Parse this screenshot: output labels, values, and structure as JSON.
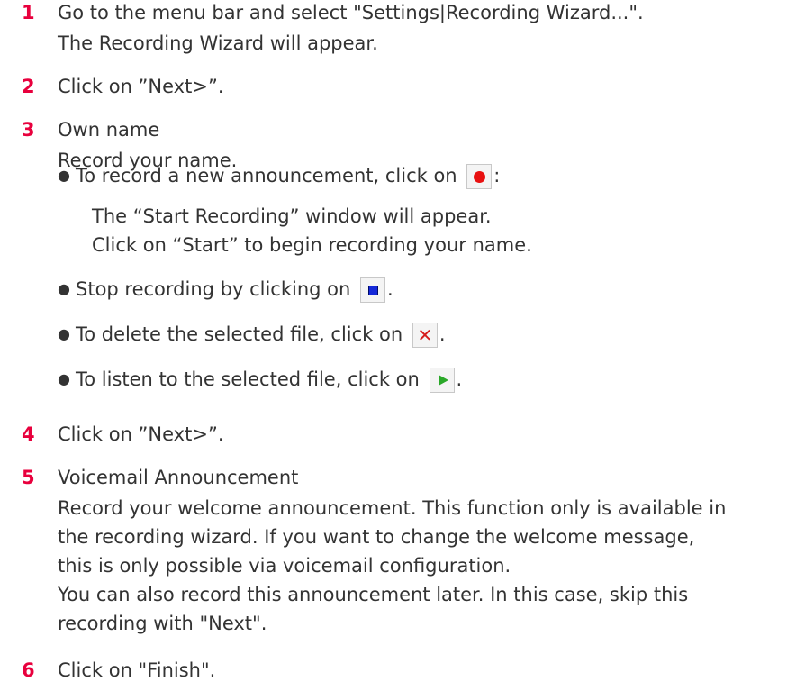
{
  "steps": [
    {
      "number": "1",
      "lines": [
        "Go to the menu bar and select \"Settings|Recording Wizard...\".",
        "The Recording Wizard will appear."
      ]
    },
    {
      "number": "2",
      "lines": [
        "Click on ”Next>”."
      ]
    },
    {
      "number": "3",
      "lines": [
        "Own name",
        "Record your name."
      ],
      "bullets": [
        {
          "text_before": "To record a new announcement, click on",
          "icon": "record-icon",
          "text_after": ":",
          "sub_lines": [
            "The “Start Recording” window will appear.",
            "Click on “Start” to begin recording your name."
          ]
        },
        {
          "text_before": "Stop recording by clicking on",
          "icon": "stop-icon",
          "text_after": "."
        },
        {
          "text_before": "To delete the selected file, click on",
          "icon": "delete-icon",
          "text_after": "."
        },
        {
          "text_before": "To listen to the selected file, click on",
          "icon": "play-icon",
          "text_after": "."
        }
      ]
    },
    {
      "number": "4",
      "lines": [
        "Click on ”Next>”."
      ]
    },
    {
      "number": "5",
      "lines": [
        "Voicemail Announcement",
        "Record your welcome announcement. This function only is available in",
        "the recording wizard. If you want to change the welcome message,",
        "this is only possible via voicemail configuration.",
        "You can also record this announcement later. In this case, skip this",
        "recording with \"Next\"."
      ]
    },
    {
      "number": "6",
      "lines": [
        "Click on \"Finish\"."
      ]
    }
  ],
  "colors": {
    "step_number": "#e8003d",
    "text": "#333333",
    "record": "#e81010",
    "stop": "#1428d8",
    "delete": "#d61b1b",
    "play": "#2aa829"
  }
}
